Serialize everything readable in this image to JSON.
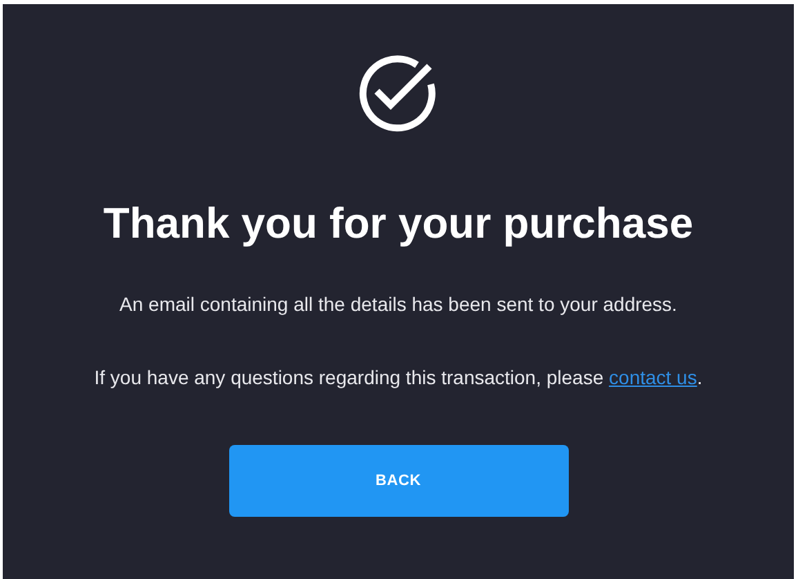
{
  "heading": "Thank you for your purchase",
  "message": "An email containing all the details has been sent to your address.",
  "question": {
    "before": "If you have any questions regarding this transaction, please ",
    "link": "contact us",
    "after": "."
  },
  "button": "BACK"
}
